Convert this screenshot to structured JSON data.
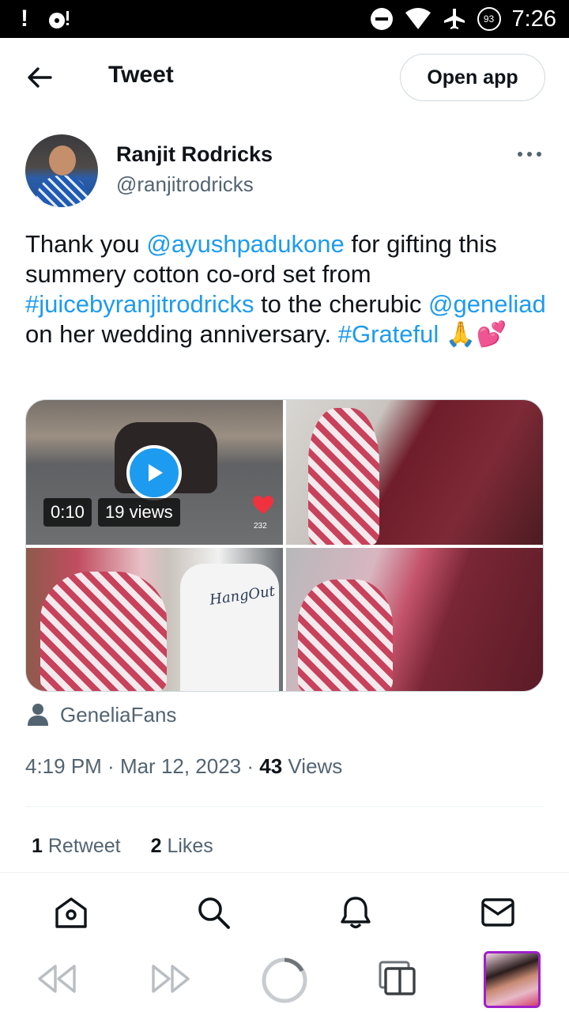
{
  "status_bar": {
    "left_icons": [
      "exclamation-icon",
      "media-icon"
    ],
    "right_icons": [
      "do-not-disturb-icon",
      "wifi-icon",
      "airplane-icon"
    ],
    "battery_level": "93",
    "time": "7:26"
  },
  "header": {
    "title": "Tweet",
    "open_app_label": "Open app"
  },
  "tweet": {
    "author_name": "Ranjit Rodricks",
    "author_handle": "@ranjitrodricks",
    "text": {
      "p1": "Thank you ",
      "mention1": "@ayushpadukone",
      "p2": " for gifting this summery cotton co-ord set from ",
      "hashtag1": "#juicebyranjitrodricks",
      "p3": " to the cherubic ",
      "mention2": "@geneliad",
      "p4": " on her wedding anniversary. ",
      "hashtag2": "#Grateful",
      "emoji": "🙏💕"
    },
    "media": {
      "video_duration": "0:10",
      "video_views": "19 views",
      "heart_count": "232",
      "shirt_text": "HangOut"
    },
    "tagged_user": "GeneliaFans",
    "time": "4:19 PM",
    "date": "Mar 12, 2023",
    "views_count": "43",
    "views_label": "Views",
    "retweets_count": "1",
    "retweets_label": "Retweet",
    "likes_count": "2",
    "likes_label": "Likes"
  },
  "bottom_nav": [
    "home-icon",
    "search-icon",
    "notifications-icon",
    "messages-icon"
  ],
  "browser_bar": [
    "back-icon",
    "forward-icon",
    "reload-icon",
    "tabs-icon",
    "tab-thumbnail"
  ],
  "colors": {
    "link": "#1d9bf0",
    "secondary_text": "#536471",
    "primary_text": "#0f1419",
    "border": "#cfd9de",
    "heart": "#f91880"
  }
}
